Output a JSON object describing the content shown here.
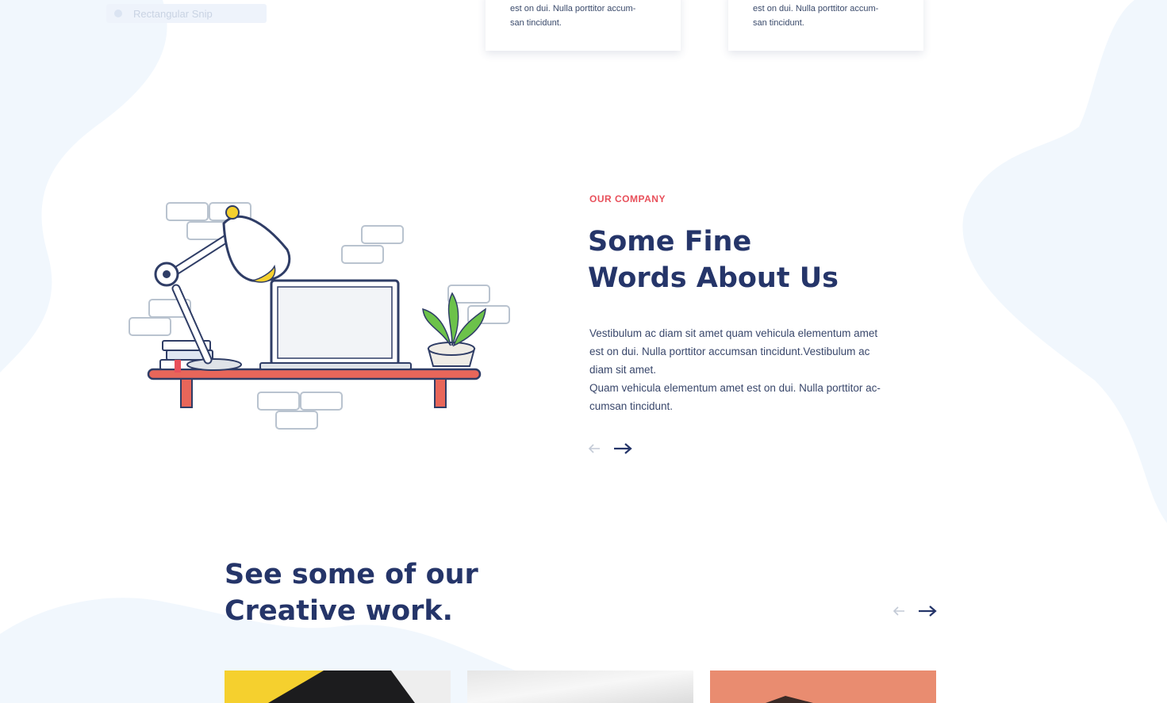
{
  "snip": {
    "label": "Rectangular Snip"
  },
  "service_cards": [
    {
      "text_line1": "est on dui. Nulla porttitor accum-",
      "text_line2": "san tincidunt."
    },
    {
      "text_line1": "est on dui. Nulla porttitor accum-",
      "text_line2": "san tincidunt."
    }
  ],
  "about": {
    "eyebrow": "OUR COMPANY",
    "title_line1": "Some Fine",
    "title_line2": "Words About Us",
    "para_line1": "Vestibulum ac diam sit amet quam vehicula elementum amet",
    "para_line2": "est on dui. Nulla porttitor accumsan tincidunt.Vestibulum ac",
    "para_line3": "diam sit amet.",
    "para_line4": "Quam vehicula elementum amet est on dui. Nulla porttitor ac-",
    "para_line5": "cumsan tincidunt.",
    "prev_icon": "arrow-left-icon",
    "next_icon": "arrow-right-icon"
  },
  "work": {
    "title_line1": "See some of our",
    "title_line2": "Creative work.",
    "prev_icon": "arrow-left-icon",
    "next_icon": "arrow-right-icon",
    "thumbnails": [
      {
        "name": "work-thumb-yellow",
        "color": "#f5d02e"
      },
      {
        "name": "work-thumb-grey",
        "color": "#e6e6e6"
      },
      {
        "name": "work-thumb-coral",
        "color": "#e98c70"
      }
    ]
  },
  "colors": {
    "accent": "#e8505b",
    "heading": "#253569",
    "body_text": "#39476b",
    "background_blob": "#f1f7fd"
  }
}
